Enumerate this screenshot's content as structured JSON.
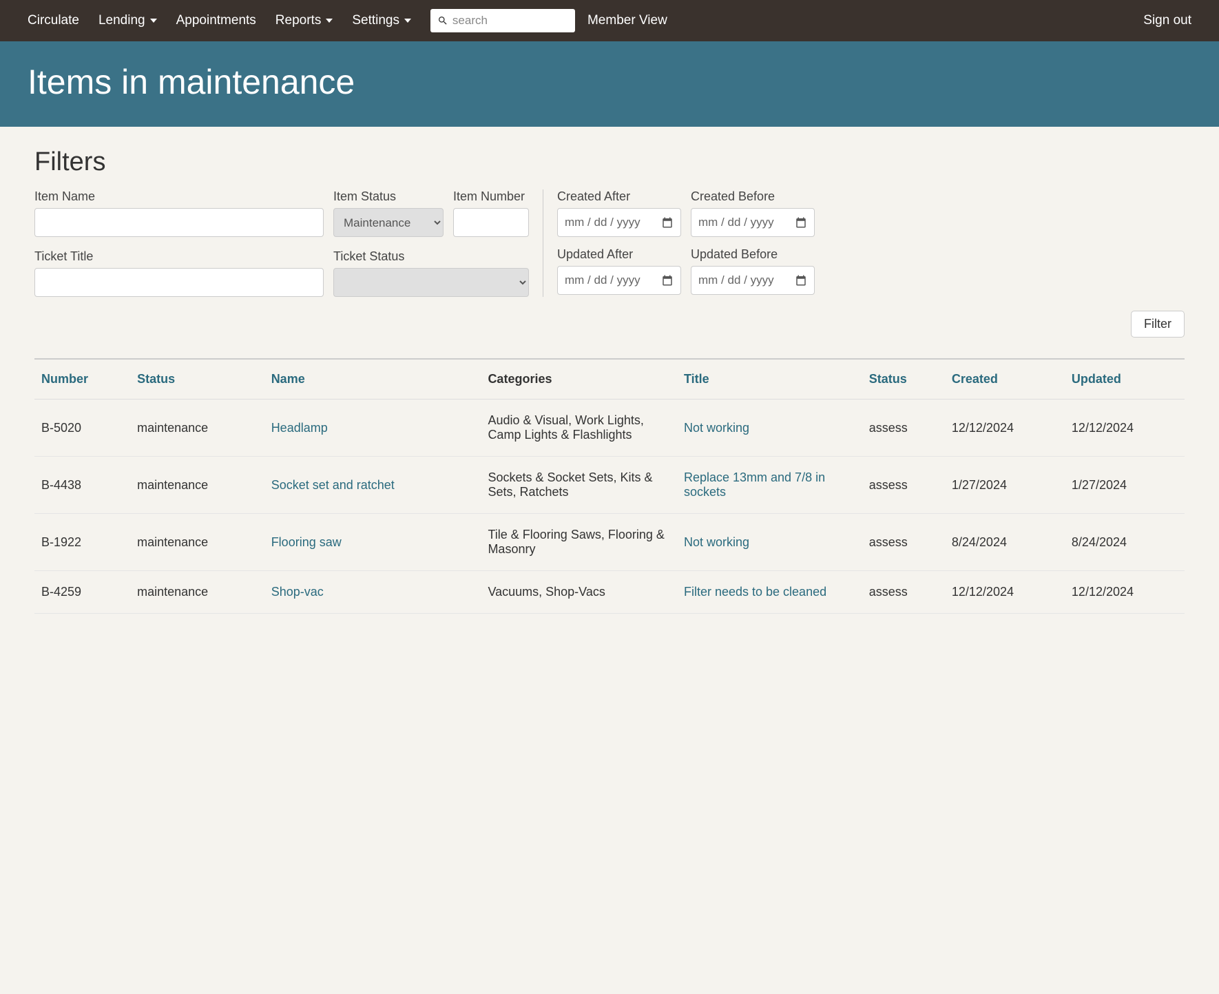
{
  "nav": {
    "circulate": "Circulate",
    "lending": "Lending",
    "appointments": "Appointments",
    "reports": "Reports",
    "settings": "Settings",
    "search_placeholder": "search",
    "member_view": "Member View",
    "sign_out": "Sign out"
  },
  "page": {
    "title": "Items in maintenance"
  },
  "filters": {
    "heading": "Filters",
    "item_name_label": "Item Name",
    "item_name_value": "",
    "item_status_label": "Item Status",
    "item_status_value": "Maintenance",
    "item_number_label": "Item Number",
    "item_number_value": "",
    "ticket_title_label": "Ticket Title",
    "ticket_title_value": "",
    "ticket_status_label": "Ticket Status",
    "ticket_status_value": "",
    "created_after_label": "Created After",
    "created_before_label": "Created Before",
    "updated_after_label": "Updated After",
    "updated_before_label": "Updated Before",
    "date_placeholder": "mm / dd / yyyy",
    "filter_button": "Filter"
  },
  "table": {
    "headers": {
      "number": "Number",
      "item_status": "Status",
      "name": "Name",
      "categories": "Categories",
      "title": "Title",
      "ticket_status": "Status",
      "created": "Created",
      "updated": "Updated"
    },
    "rows": [
      {
        "number": "B-5020",
        "item_status": "maintenance",
        "name": "Headlamp",
        "categories": "Audio & Visual, Work Lights, Camp Lights & Flashlights",
        "title": "Not working",
        "ticket_status": "assess",
        "created": "12/12/2024",
        "updated": "12/12/2024"
      },
      {
        "number": "B-4438",
        "item_status": "maintenance",
        "name": "Socket set and ratchet",
        "categories": "Sockets & Socket Sets, Kits & Sets, Ratchets",
        "title": "Replace 13mm and 7/8 in sockets",
        "ticket_status": "assess",
        "created": "1/27/2024",
        "updated": "1/27/2024"
      },
      {
        "number": "B-1922",
        "item_status": "maintenance",
        "name": "Flooring saw",
        "categories": "Tile & Flooring Saws, Flooring & Masonry",
        "title": "Not working",
        "ticket_status": "assess",
        "created": "8/24/2024",
        "updated": "8/24/2024"
      },
      {
        "number": "B-4259",
        "item_status": "maintenance",
        "name": "Shop-vac",
        "categories": "Vacuums, Shop-Vacs",
        "title": "Filter needs to be cleaned",
        "ticket_status": "assess",
        "created": "12/12/2024",
        "updated": "12/12/2024"
      }
    ]
  }
}
